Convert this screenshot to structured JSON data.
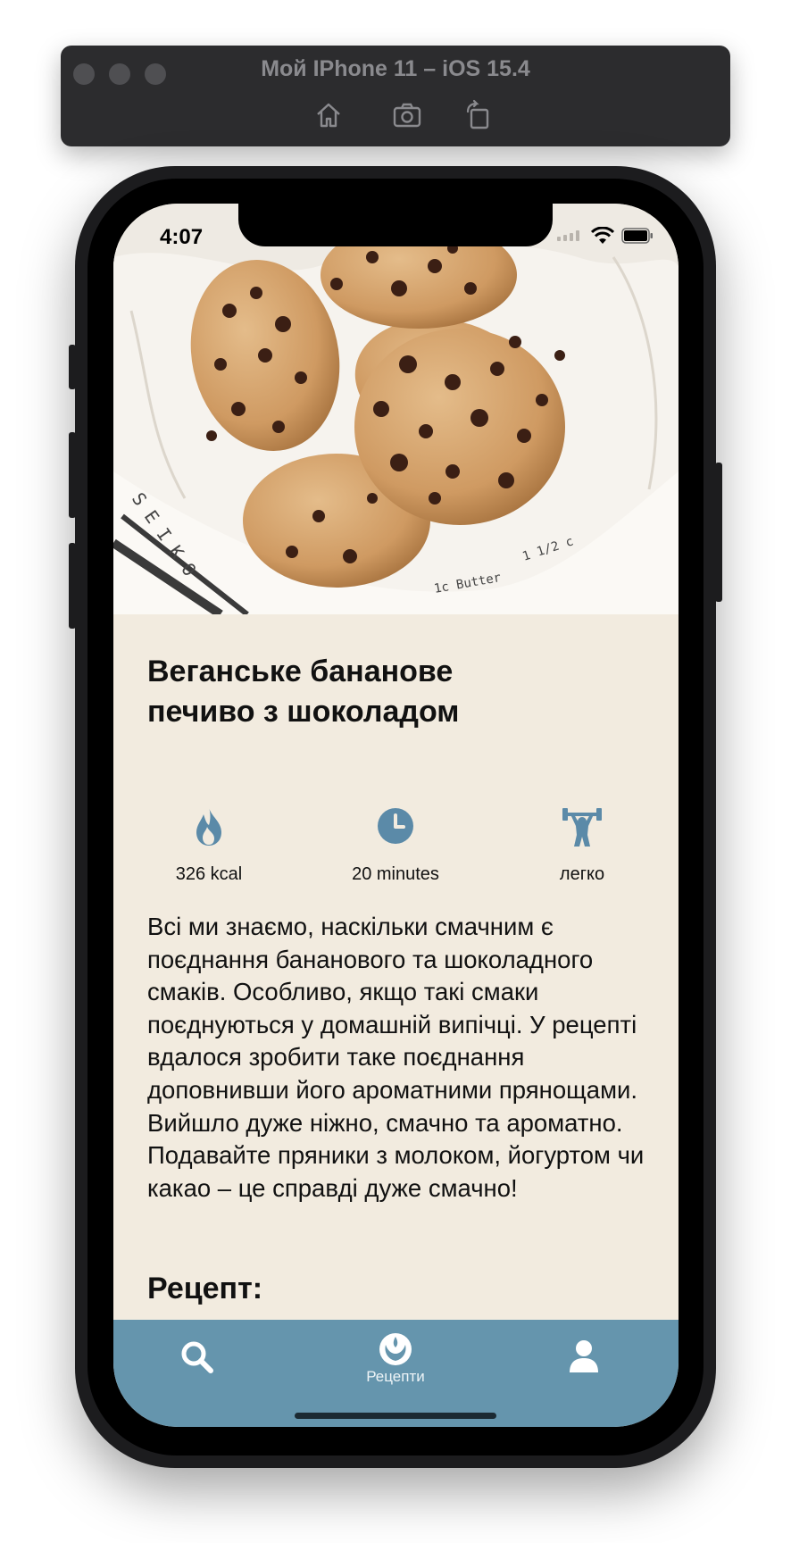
{
  "simulator": {
    "title": "Мой IPhone 11 – iOS 15.4",
    "buttons": [
      "home-icon",
      "screenshot-icon",
      "rotate-icon"
    ]
  },
  "status_bar": {
    "time": "4:07"
  },
  "recipe": {
    "title": "Веганське бананове печиво з шоколадом",
    "stats": {
      "calories": "326 kcal",
      "time": "20 minutes",
      "difficulty": "легко"
    },
    "description": "Всі ми знаємо, наскільки смачним є поєднання бананового та шоколадного смаків. Особливо, якщо такі смаки поєднуються у домашній випічці. У рецепті вдалося зробити таке поєднання доповнивши його ароматними прянощами. Вийшло дуже ніжно, смачно та ароматно. Подавайте пряники з молоком, йогуртом чи какао – це справді дуже смачно!",
    "section_heading": "Рецепт:"
  },
  "tabbar": {
    "center_label": "Рецепти"
  },
  "colors": {
    "accent": "#6595ad",
    "background": "#f2ebdf",
    "icon": "#5b8aa8"
  }
}
